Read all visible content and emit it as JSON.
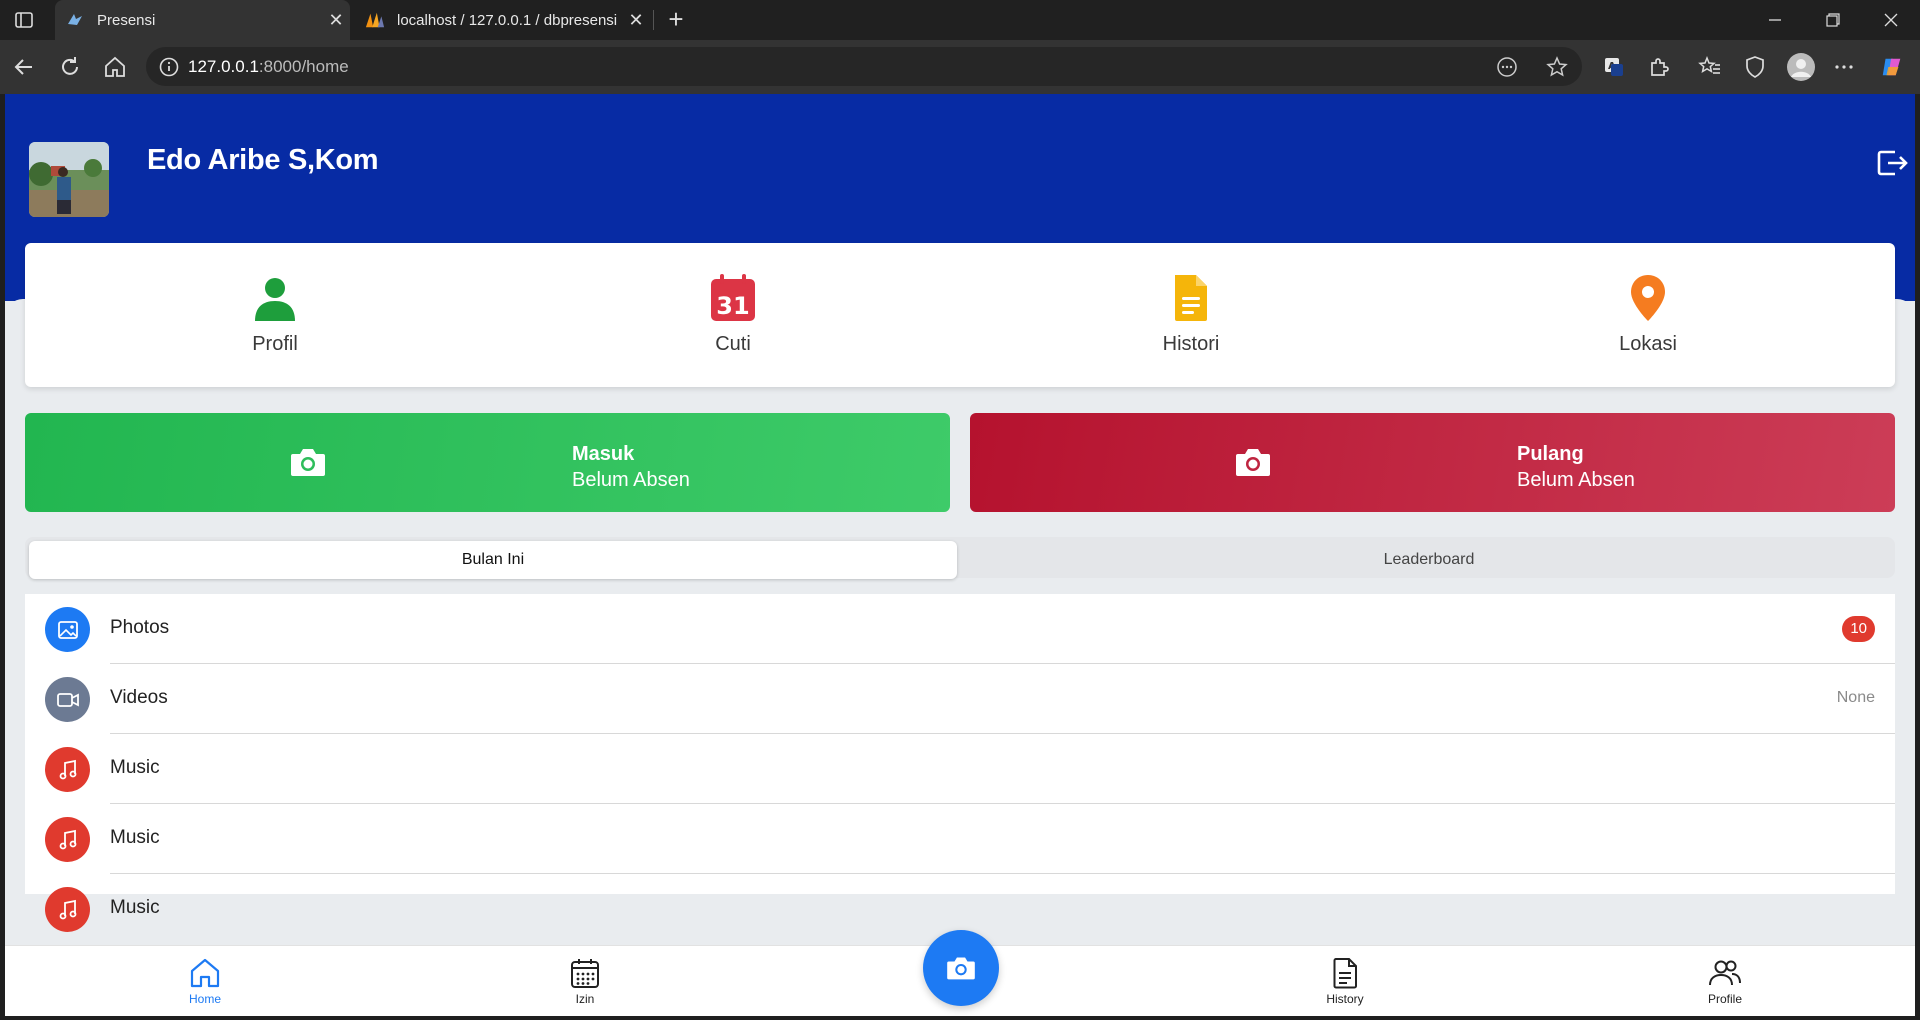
{
  "browser": {
    "tabs": [
      {
        "title": "Presensi",
        "active": true
      },
      {
        "title": "localhost / 127.0.0.1 / dbpresensi",
        "active": false
      }
    ],
    "url_host": "127.0.0.1",
    "url_rest": ":8000/home"
  },
  "header": {
    "user_name": "Edo Aribe S,Kom"
  },
  "menu": [
    {
      "label": "Profil",
      "icon": "person-icon",
      "color": "#1e9e3c"
    },
    {
      "label": "Cuti",
      "icon": "calendar-icon",
      "color": "#dc3545",
      "day": "31"
    },
    {
      "label": "Histori",
      "icon": "document-icon",
      "color": "#f5b50a"
    },
    {
      "label": "Lokasi",
      "icon": "location-pin-icon",
      "color": "#f57c20"
    }
  ],
  "attendance": {
    "masuk": {
      "title": "Masuk",
      "status": "Belum Absen",
      "color": "#22b650"
    },
    "pulang": {
      "title": "Pulang",
      "status": "Belum Absen",
      "color": "#b5122e"
    }
  },
  "segments": [
    {
      "label": "Bulan Ini",
      "active": true
    },
    {
      "label": "Leaderboard",
      "active": false
    }
  ],
  "list": [
    {
      "label": "Photos",
      "icon": "image-icon",
      "color": "#1d7af3",
      "badge": "10"
    },
    {
      "label": "Videos",
      "icon": "video-icon",
      "color": "#6c7a93",
      "note": "None"
    },
    {
      "label": "Music",
      "icon": "music-icon",
      "color": "#e03a2e"
    },
    {
      "label": "Music",
      "icon": "music-icon",
      "color": "#e03a2e"
    },
    {
      "label": "Music",
      "icon": "music-icon",
      "color": "#e03a2e"
    }
  ],
  "bottom_nav": [
    {
      "label": "Home",
      "icon": "home-icon",
      "active": true
    },
    {
      "label": "Izin",
      "icon": "calendar-icon",
      "active": false
    },
    {
      "label": "History",
      "icon": "document-icon",
      "active": false
    },
    {
      "label": "Profile",
      "icon": "people-icon",
      "active": false
    }
  ]
}
